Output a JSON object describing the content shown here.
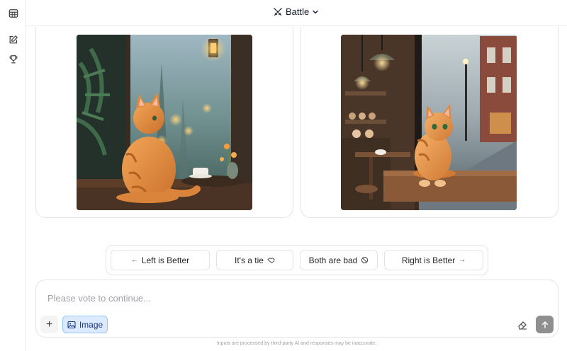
{
  "sidebar": {
    "items": [
      {
        "icon": "table-icon"
      },
      {
        "icon": "edit-icon"
      },
      {
        "icon": "trophy-icon"
      }
    ]
  },
  "header": {
    "mode_label": "Battle",
    "mode_icon": "swords-icon"
  },
  "battle": {
    "left": {
      "image": "orange-cat-window-rain-cafe"
    },
    "right": {
      "image": "orange-cat-cafe-counter-rain"
    }
  },
  "vote": {
    "left_better": "Left is Better",
    "tie": "It's a tie",
    "both_bad": "Both are bad",
    "right_better": "Right is Better"
  },
  "composer": {
    "placeholder": "Please vote to continue...",
    "image_button": "Image"
  },
  "footer": {
    "disclaimer": "Inputs are processed by third-party AI and responses may be inaccurate."
  },
  "colors": {
    "accent_blue": "#dbeafe",
    "send_button": "#8f8f8f"
  }
}
